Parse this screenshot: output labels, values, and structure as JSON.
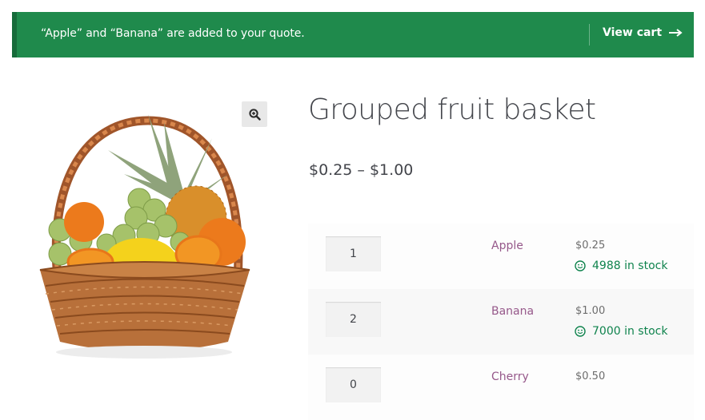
{
  "notice": {
    "message": "“Apple” and “Banana” are added to your quote.",
    "view_cart_label": "View cart",
    "arrow_icon": "arrow-right-icon",
    "background_color": "#1f8a4c"
  },
  "gallery": {
    "image_alt": "fruit basket image",
    "zoom_icon": "zoom-in-icon"
  },
  "product": {
    "title": "Grouped fruit basket",
    "price_range": "$0.25 – $1.00"
  },
  "grouped_items": [
    {
      "quantity": "1",
      "name": "Apple",
      "price": "$0.25",
      "stock": "4988 in stock",
      "stock_icon": "smile-icon"
    },
    {
      "quantity": "2",
      "name": "Banana",
      "price": "$1.00",
      "stock": "7000 in stock",
      "stock_icon": "smile-icon"
    },
    {
      "quantity": "0",
      "name": "Cherry",
      "price": "$0.50",
      "stock": ""
    }
  ],
  "colors": {
    "link": "#96588a",
    "in_stock": "#0f834d",
    "notice_bg": "#1f8a4c"
  }
}
